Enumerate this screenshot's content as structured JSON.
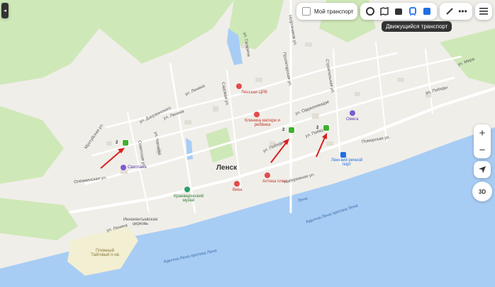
{
  "toolbar": {
    "my_transport_label": "Мой транспорт",
    "tooltip": "Движущийся транспорт"
  },
  "streets": {
    "s1": "Мухтуйская ул.",
    "s2": "ул. Ленина",
    "s3": "Олёкминская ул.",
    "s4": "ул. Дзержинского",
    "s5": "ул. Победы",
    "s6": "ул. Орджоникидзе",
    "s7": "Набережная ул.",
    "s8": "Поморская ул.",
    "s9": "ул. Победы",
    "s10": "Советская ул.",
    "s11": "ул. Чапаева",
    "s12": "ул. Ленина",
    "s13": "ул. Победы",
    "s14": "Нефтяников ул.",
    "s15": "Пролетарская ул.",
    "s16": "Садовая ул.",
    "s17": "ул. Гагарина",
    "s18": "ул. Ленина",
    "s19": "Строительная ул.",
    "s20": "ул. Мира"
  },
  "pois": {
    "hospital": "Ленская ЦРВ",
    "maternity": "Клиника матери и ребёнка",
    "svetlana": "Светлана",
    "museum": "Краеведческий музей",
    "pharmacy": "Аптека плюс",
    "port": "Ленский речной порт",
    "vika": "Вика",
    "omega": "Омега",
    "church": "Иннокентьевская церковь",
    "sands": "Пляжный Тайговый п-ов",
    "river": "Лена",
    "river2": "Адычча-Лена протока Лена",
    "river3": "Адычча-Лена протока Лена"
  },
  "city_name": "Ленск",
  "stops": [
    "2",
    "2",
    "2"
  ],
  "zoom_in": "+",
  "zoom_out": "−",
  "view3d": "3D",
  "colors": {
    "water": "#a8cdf5",
    "park": "#cfe8b8",
    "land": "#f0eee9",
    "road": "#ffffff",
    "accent": "#1e6fe5",
    "bus": "#3eb130"
  }
}
